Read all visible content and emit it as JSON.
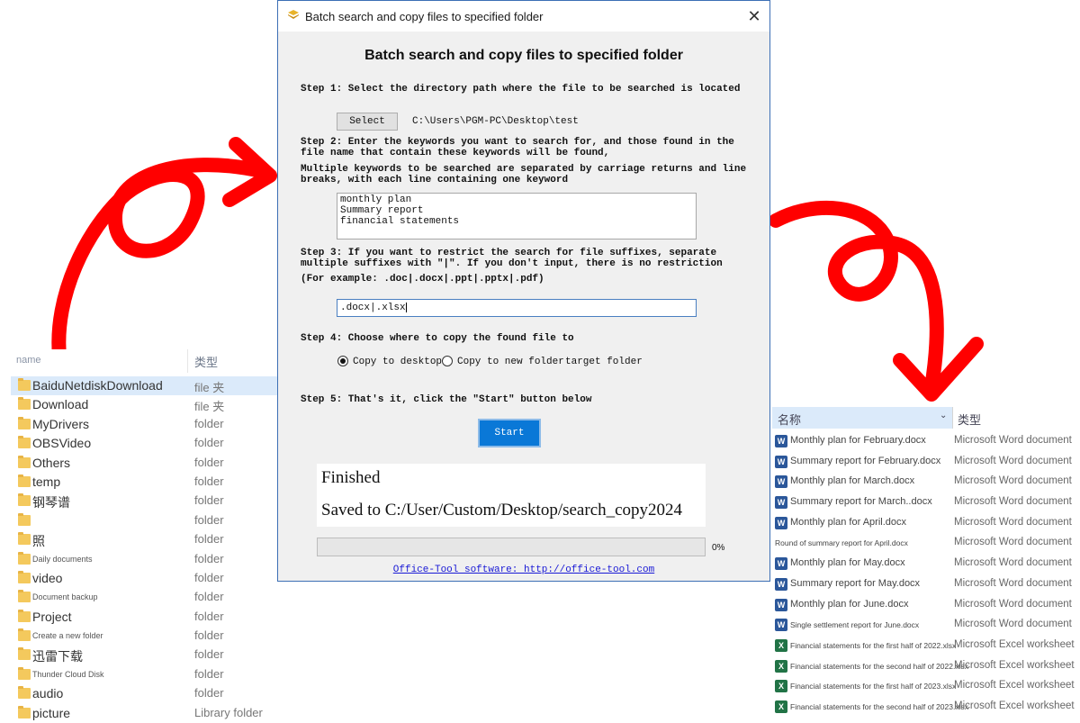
{
  "left_panel": {
    "header": {
      "name": "name",
      "type": "类型"
    },
    "rows": [
      {
        "name": "BaiduNetdiskDownload",
        "type": "file 夹",
        "selected": true
      },
      {
        "name": "Download",
        "type": "file 夹"
      },
      {
        "name": "MyDrivers",
        "type": "folder"
      },
      {
        "name": "OBSVideo",
        "type": "folder"
      },
      {
        "name": "Others",
        "type": "folder"
      },
      {
        "name": "temp",
        "type": "folder"
      },
      {
        "name": "钢琴谱",
        "type": "folder"
      },
      {
        "name": "",
        "type": "folder"
      },
      {
        "name": "照",
        "type": "folder"
      },
      {
        "name": "Daily documents",
        "type": "folder",
        "small": true
      },
      {
        "name": "video",
        "type": "folder"
      },
      {
        "name": "Document backup",
        "type": "folder",
        "small": true
      },
      {
        "name": "Project",
        "type": "folder"
      },
      {
        "name": "Create a new folder",
        "type": "folder",
        "small": true
      },
      {
        "name": "迅雷下载",
        "type": "folder"
      },
      {
        "name": "Thunder Cloud Disk",
        "type": "folder",
        "small": true
      },
      {
        "name": "audio",
        "type": "folder"
      },
      {
        "name": "picture",
        "type": "Library folder"
      }
    ]
  },
  "dialog": {
    "title": "Batch search and copy files to specified folder",
    "heading": "Batch search and copy files to specified folder",
    "step1": "Step 1: Select the directory path where the file to be searched is located",
    "select_label": "Select",
    "path": "C:\\Users\\PGM-PC\\Desktop\\test",
    "step2_a": "Step 2: Enter the keywords you want to search for, and those found in the file name that contain these keywords will be found,",
    "step2_b": "Multiple keywords to be searched are separated by carriage returns and line breaks, with each line containing one keyword",
    "keywords": "monthly plan\nSummary report\nfinancial statements",
    "step3": "Step 3: If you want to restrict the search for file suffixes, separate multiple suffixes with \"|\". If you don't input, there is no restriction",
    "step3_example": "(For example: .doc|.docx|.ppt|.pptx|.pdf)",
    "suffix_value": ".docx|.xlsx",
    "step4": "Step 4: Choose where to copy the found file to",
    "radio1_label": "Copy to desktop",
    "radio2_label": "Copy to new folder",
    "target_folder_label": "target folder",
    "step5": "Step 5: That's it, click the \"Start\" button below",
    "start_label": "Start",
    "result_line1": "Finished",
    "result_line2": "Saved to C:/User/Custom/Desktop/search_copy2024",
    "progress_percent": 0,
    "progress_text": "0%",
    "footer": "Office-Tool software: http://office-tool.com"
  },
  "right_panel": {
    "header": {
      "name": "名称",
      "type": "类型"
    },
    "rows": [
      {
        "name": "Monthly plan for February.docx",
        "type": "Microsoft Word document",
        "icon": "word"
      },
      {
        "name": "Summary report for February.docx",
        "type": "Microsoft Word document",
        "icon": "word"
      },
      {
        "name": "Monthly plan for March.docx",
        "type": "Microsoft Word document",
        "icon": "word"
      },
      {
        "name": "Summary report for March..docx",
        "type": "Microsoft Word document",
        "icon": "word"
      },
      {
        "name": "Monthly plan for April.docx",
        "type": "Microsoft Word document",
        "icon": "word"
      },
      {
        "name": "Round of summary report for April.docx",
        "type": "Microsoft Word document",
        "icon": "none",
        "tiny": true
      },
      {
        "name": "Monthly plan for May.docx",
        "type": "Microsoft Word document",
        "icon": "word"
      },
      {
        "name": "Summary report for May.docx",
        "type": "Microsoft Word document",
        "icon": "word"
      },
      {
        "name": "Monthly plan for June.docx",
        "type": "Microsoft Word document",
        "icon": "word"
      },
      {
        "name": "Single settlement report for June.docx",
        "type": "Microsoft Word document",
        "icon": "word",
        "tiny": true
      },
      {
        "name": "Financial statements for the first half of 2022.xlsx",
        "type": "Microsoft Excel worksheet",
        "icon": "excel",
        "tiny": true
      },
      {
        "name": "Financial statements for the second half of 2022.xlsx",
        "type": "Microsoft Excel worksheet",
        "icon": "excel",
        "tiny": true
      },
      {
        "name": "Financial statements for the first half of 2023.xlsx",
        "type": "Microsoft Excel worksheet",
        "icon": "excel",
        "tiny": true
      },
      {
        "name": "Financial statements for the second half of 2023.xlsx",
        "type": "Microsoft Excel worksheet",
        "icon": "excel",
        "tiny": true
      }
    ]
  },
  "colors": {
    "arrow": "#ff0000",
    "start_button": "#0a78d7",
    "dialog_border": "#3c6fb5"
  }
}
